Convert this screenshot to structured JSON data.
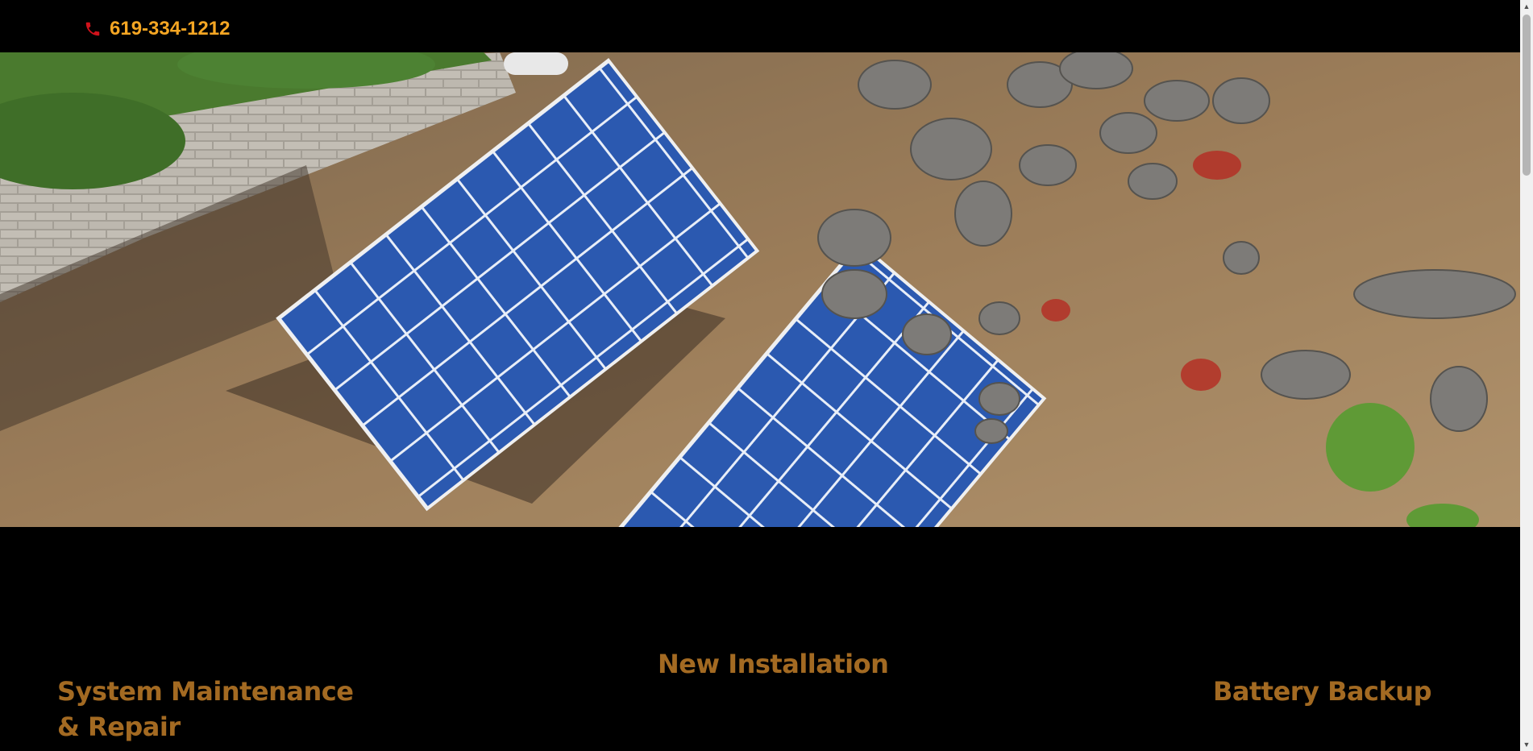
{
  "header": {
    "phone": "619-334-1212",
    "phone_icon": "phone-icon",
    "accent_color": "#f5a623"
  },
  "hero": {
    "image": "aerial-solar-panels-on-hillside"
  },
  "services": {
    "maintenance_line1": "System Maintenance",
    "maintenance_line2": "& Repair",
    "installation": "New Installation",
    "battery": "Battery Backup",
    "color": "#a36a22"
  }
}
